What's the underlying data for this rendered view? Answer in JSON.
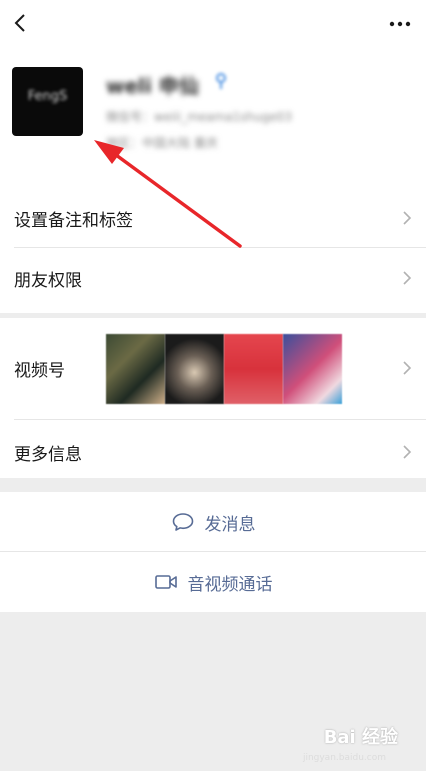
{
  "header": {
    "back_icon": "chevron-left-icon",
    "more_icon": "more-dots-icon"
  },
  "profile": {
    "avatar_text": "FengS",
    "name": "weli 申仙",
    "wechat_id": "微信号：weiii_meama1shuge03",
    "region": "地区：中国大陆 重庆"
  },
  "menu": {
    "remark_tags": "设置备注和标签",
    "friend_permissions": "朋友权限",
    "channels": "视频号",
    "more_info": "更多信息"
  },
  "actions": {
    "send_message": "发消息",
    "video_call": "音视频通话"
  },
  "watermark": {
    "text": "Bai 经验",
    "sub": "jingyan.baidu.com"
  },
  "colors": {
    "link_blue": "#576b95",
    "annotation_red": "#e8262a"
  }
}
